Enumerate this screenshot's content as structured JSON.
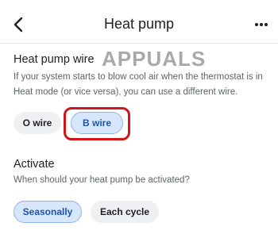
{
  "header": {
    "title": "Heat pump"
  },
  "watermark": {
    "text": "APPUALS"
  },
  "wire_section": {
    "title": "Heat pump wire",
    "description": "If your system starts to blow cool air when the thermostat is in Heat mode (or vice versa), you can use a different wire.",
    "options": [
      "O wire",
      "B wire"
    ],
    "selected": "B wire"
  },
  "activate_section": {
    "title": "Activate",
    "description": "When should your heat pump be activated?",
    "options": [
      "Seasonally",
      "Each cycle"
    ],
    "selected": "Seasonally"
  },
  "colors": {
    "selected_chip_bg": "#d7e6fb",
    "selected_chip_text": "#1a56b0",
    "unselected_chip_bg": "#eef0f2",
    "highlight": "#d1151b"
  },
  "icons": {
    "back": "chevron-left",
    "more": "more-dots-horizontal"
  }
}
